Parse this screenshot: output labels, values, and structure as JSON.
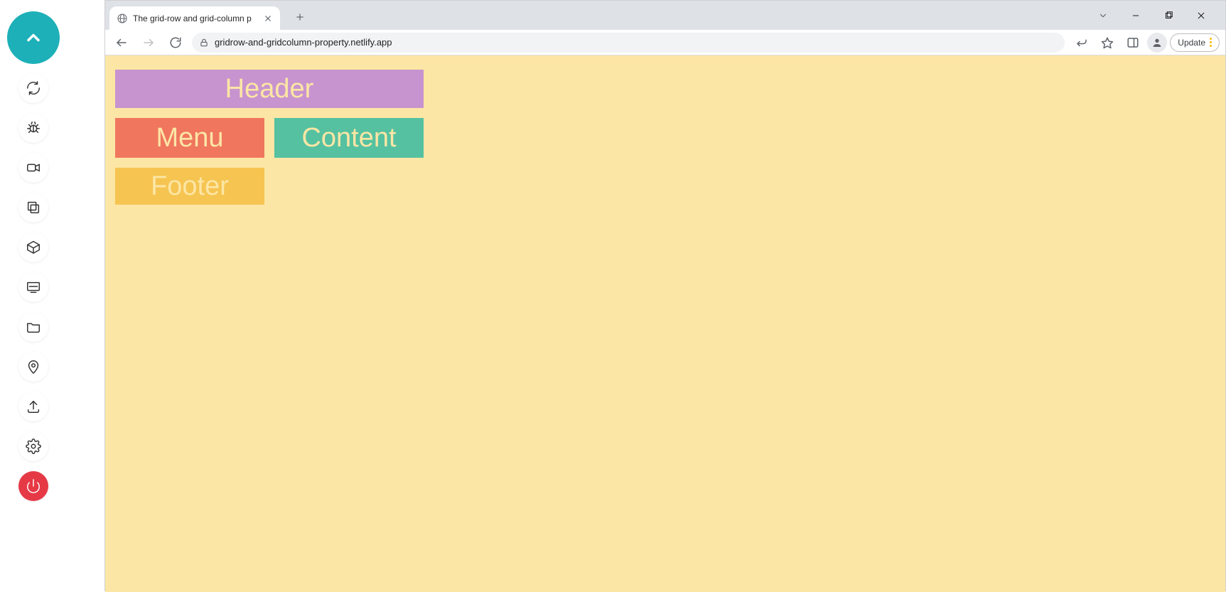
{
  "sidebar_tools": [
    {
      "name": "sync-icon",
      "shape": "sync"
    },
    {
      "name": "bug-icon",
      "shape": "bug"
    },
    {
      "name": "video-icon",
      "shape": "video"
    },
    {
      "name": "copy-icon",
      "shape": "copy"
    },
    {
      "name": "cube-icon",
      "shape": "cube"
    },
    {
      "name": "screen-icon",
      "shape": "screen"
    },
    {
      "name": "folder-icon",
      "shape": "folder"
    },
    {
      "name": "location-icon",
      "shape": "pin"
    },
    {
      "name": "upload-icon",
      "shape": "upload"
    },
    {
      "name": "settings-icon",
      "shape": "gear"
    }
  ],
  "browser": {
    "tab": {
      "title": "The grid-row and grid-column p"
    },
    "url": "gridrow-and-gridcolumn-property.netlify.app",
    "update_label": "Update"
  },
  "page": {
    "colors": {
      "page_bg": "#fce6a5",
      "header": "#c894cf",
      "menu": "#f0765e",
      "content": "#55c1a1",
      "footer": "#f6c451",
      "text": "#fce6a5"
    },
    "cells": {
      "header": "Header",
      "menu": "Menu",
      "content": "Content",
      "footer": "Footer"
    }
  }
}
